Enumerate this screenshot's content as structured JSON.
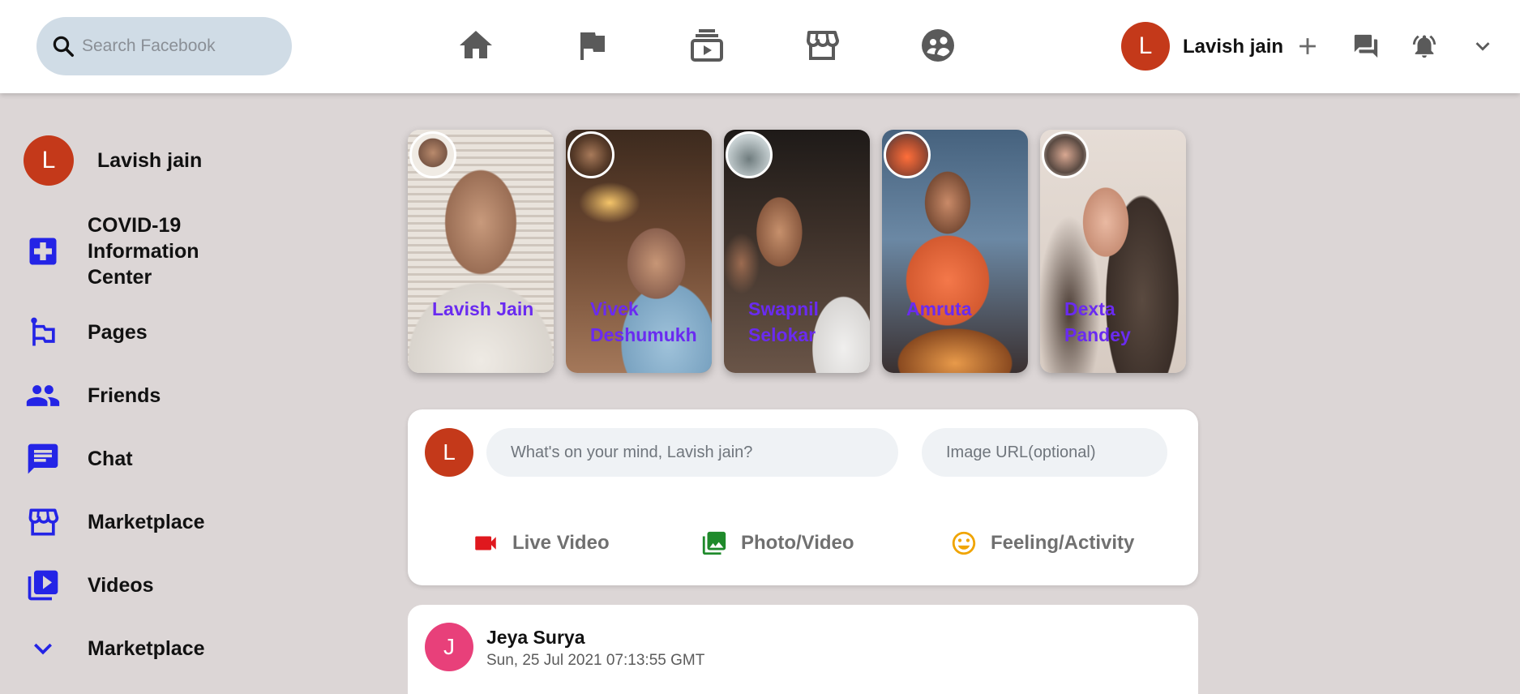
{
  "search": {
    "placeholder": "Search Facebook",
    "icon": "search-icon"
  },
  "nav": [
    {
      "name": "home",
      "icon": "home-icon"
    },
    {
      "name": "pages",
      "icon": "flag-icon"
    },
    {
      "name": "watch",
      "icon": "video-subscriptions-icon"
    },
    {
      "name": "marketplace",
      "icon": "storefront-icon"
    },
    {
      "name": "groups",
      "icon": "supervised-user-icon"
    }
  ],
  "user": {
    "initial": "L",
    "name": "Lavish jain",
    "color": "#c4391a"
  },
  "sidebar": {
    "profile_name": "Lavish jain",
    "items": [
      {
        "label": "COVID-19 Information Center",
        "icon": "local-hospital-icon"
      },
      {
        "label": "Pages",
        "icon": "emoji-flags-icon"
      },
      {
        "label": "Friends",
        "icon": "people-icon"
      },
      {
        "label": "Chat",
        "icon": "chat-icon"
      },
      {
        "label": "Marketplace",
        "icon": "storefront-icon"
      },
      {
        "label": "Videos",
        "icon": "video-library-icon"
      },
      {
        "label": "Marketplace",
        "icon": "expand-more-icon"
      }
    ],
    "accent": "#2424e6"
  },
  "stories": [
    {
      "name": "Lavish Jain"
    },
    {
      "name": "Vivek Deshumukh"
    },
    {
      "name": "Swapnil Selokar"
    },
    {
      "name": "Amruta"
    },
    {
      "name": "Dexta Pandey"
    }
  ],
  "composer": {
    "avatar_initial": "L",
    "text_placeholder": "What's on your mind, Lavish jain?",
    "image_placeholder": "Image URL(optional)",
    "actions": [
      {
        "label": "Live Video",
        "icon": "videocam-icon",
        "color": "#e0181e"
      },
      {
        "label": "Photo/Video",
        "icon": "photo-library-icon",
        "color": "#1f8a2b"
      },
      {
        "label": "Feeling/Activity",
        "icon": "insert-emoticon-icon",
        "color": "#f0a400"
      }
    ]
  },
  "post": {
    "avatar_initial": "J",
    "author": "Jeya Surya",
    "timestamp": "Sun, 25 Jul 2021 07:13:55 GMT",
    "avatar_color": "#e8407a"
  }
}
